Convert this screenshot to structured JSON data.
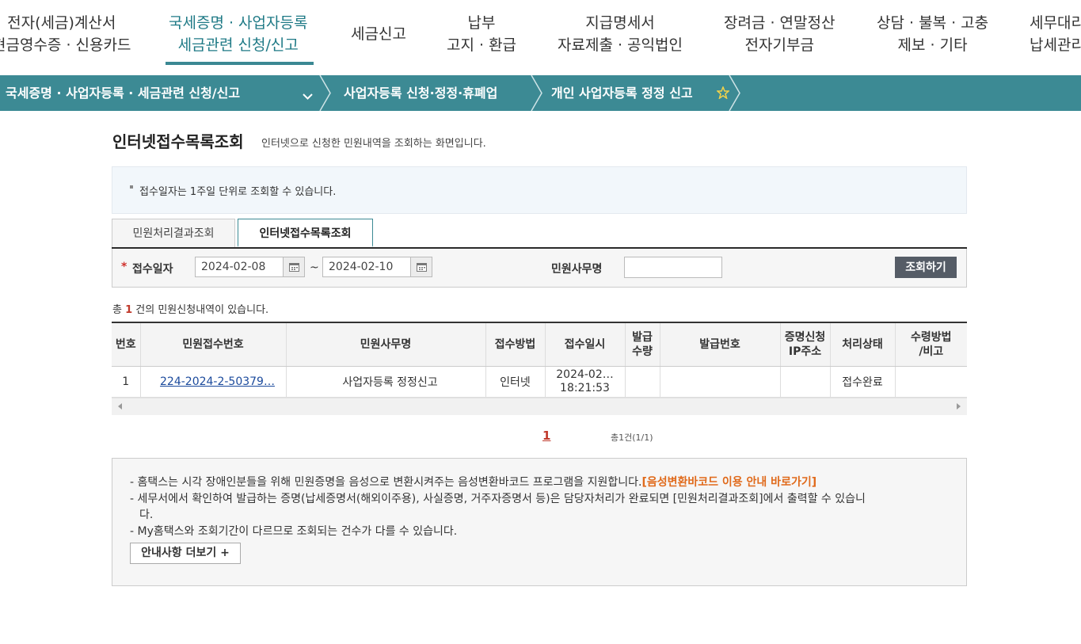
{
  "topnav": {
    "items": [
      {
        "line1": "전자(세금)계산서",
        "line2": "현금영수증 · 신용카드"
      },
      {
        "line1": "국세증명 · 사업자등록",
        "line2": "세금관련 신청/신고"
      },
      {
        "line1": "세금신고",
        "line2": ""
      },
      {
        "line1": "납부",
        "line2": "고지 · 환급"
      },
      {
        "line1": "지급명세서",
        "line2": "자료제출 · 공익법인"
      },
      {
        "line1": "장려금 · 연말정산",
        "line2": "전자기부금"
      },
      {
        "line1": "상담 · 불복 · 고충",
        "line2": "제보 · 기타"
      },
      {
        "line1": "세무대리",
        "line2": "납세관리"
      }
    ]
  },
  "breadcrumb": {
    "level1": "국세증명 · 사업자등록 · 세금관련 신청/신고",
    "level2": "사업자등록 신청·정정·휴폐업",
    "level3": "개인 사업자등록 정정 신고"
  },
  "page": {
    "title": "인터넷접수목록조회",
    "desc": "인터넷으로 신청한 민원내역을 조회하는 화면입니다.",
    "info": "접수일자는 1주일 단위로 조회할 수 있습니다."
  },
  "tabs": [
    {
      "label": "민원처리결과조회"
    },
    {
      "label": "인터넷접수목록조회"
    }
  ],
  "search": {
    "date_label": "접수일자",
    "required_mark": "*",
    "date_from": "2024-02-08",
    "tilde": "~",
    "date_to": "2024-02-10",
    "name_label": "민원사무명",
    "button": "조회하기"
  },
  "count": {
    "prefix": "총",
    "num": "1",
    "suffix": "건의 민원신청내역이 있습니다."
  },
  "table": {
    "headers": [
      {
        "l1": "번호",
        "l2": ""
      },
      {
        "l1": "민원접수번호",
        "l2": ""
      },
      {
        "l1": "민원사무명",
        "l2": ""
      },
      {
        "l1": "접수방법",
        "l2": ""
      },
      {
        "l1": "접수일시",
        "l2": ""
      },
      {
        "l1": "발급",
        "l2": "수량"
      },
      {
        "l1": "발급번호",
        "l2": ""
      },
      {
        "l1": "증명신청",
        "l2": "IP주소"
      },
      {
        "l1": "처리상태",
        "l2": ""
      },
      {
        "l1": "수령방법",
        "l2": "/비고"
      }
    ],
    "rows": [
      {
        "no": "1",
        "receipt_no": "224-2024-2-50379…",
        "name": "사업자등록 정정신고",
        "method": "인터넷",
        "date1": "2024-02…",
        "date2": "18:21:53",
        "qty": "",
        "issue_no": "",
        "ip": "",
        "status": "접수완료",
        "receive": ""
      }
    ]
  },
  "pager": {
    "current": "1",
    "total": "총1건(1/1)"
  },
  "notice": {
    "line1": "- 홈택스는 시각 장애인분들을 위해 민원증명을 음성으로 변환시켜주는 음성변환바코드 프로그램을 지원합니다.",
    "line1_link": "[음성변환바코드 이용 안내 바로가기]",
    "line2a": "- 세무서에서 확인하여 발급하는 증명(납세증명서(해외이주용), 사실증명, 거주자증명서 등)은 담당자처리가 완료되면 [민원처리결과조회]에서 출력할 수 있습니",
    "line2b": "다.",
    "line3": "- My홈택스와 조회기간이 다르므로 조회되는 건수가 다를 수 있습니다.",
    "more_button": "안내사항 더보기 +"
  }
}
